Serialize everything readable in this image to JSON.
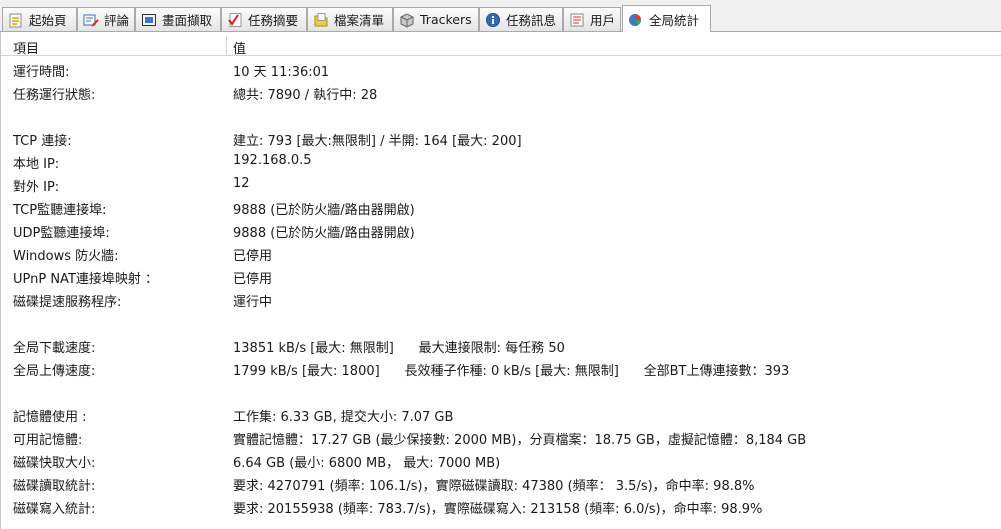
{
  "tabs": [
    {
      "label": "起始頁",
      "icon": "start-page-icon"
    },
    {
      "label": "評論",
      "icon": "comments-icon"
    },
    {
      "label": "畫面擷取",
      "icon": "screenshot-icon"
    },
    {
      "label": "任務摘要",
      "icon": "checklist-icon"
    },
    {
      "label": "檔案清單",
      "icon": "file-list-icon"
    },
    {
      "label": "Trackers",
      "icon": "trackers-icon"
    },
    {
      "label": "任務訊息",
      "icon": "info-icon"
    },
    {
      "label": "用戶",
      "icon": "users-icon"
    },
    {
      "label": "全局統計",
      "icon": "statistics-icon"
    }
  ],
  "active_tab": 8,
  "columns": {
    "item": "項目",
    "value": "值"
  },
  "rows": [
    {
      "label": "運行時間:",
      "value": "10 天 11:36:01"
    },
    {
      "label": "任務運行狀態:",
      "value": "總共: 7890 / 執行中: 28"
    },
    {
      "label": "",
      "value": ""
    },
    {
      "label": "TCP 連接:",
      "value": "建立: 793 [最大:無限制] / 半開: 164 [最大: 200]"
    },
    {
      "label": "本地 IP:",
      "value": "192.168.0.5"
    },
    {
      "label": "對外 IP:",
      "value": "12"
    },
    {
      "label": "TCP監聽連接埠:",
      "value": "9888 (已於防火牆/路由器開啟)"
    },
    {
      "label": "UDP監聽連接埠:",
      "value": "9888 (已於防火牆/路由器開啟)"
    },
    {
      "label": "Windows 防火牆:",
      "value": "已停用"
    },
    {
      "label": "UPnP NAT連接埠映射 ：",
      "value": "已停用"
    },
    {
      "label": "磁碟提速服務程序:",
      "value": "運行中"
    },
    {
      "label": "",
      "value": ""
    },
    {
      "label": "全局下載速度:",
      "value": "13851 kB/s [最大: 無限制]      最大連接限制: 每任務 50"
    },
    {
      "label": "全局上傳速度:",
      "value": "1799 kB/s [最大: 1800]      長效種子作種: 0 kB/s [最大: 無限制]      全部BT上傳連接數：393"
    },
    {
      "label": "",
      "value": ""
    },
    {
      "label": "記憶體使用 :",
      "value": "工作集: 6.33 GB, 提交大小: 7.07 GB"
    },
    {
      "label": "可用記憶體:",
      "value": "實體記憶體：17.27 GB (最少保接數: 2000 MB)，分頁檔案：18.75 GB，虛擬記憶體：8,184 GB"
    },
    {
      "label": "磁碟快取大小:",
      "value": "6.64 GB (最小: 6800 MB， 最大: 7000 MB)"
    },
    {
      "label": "磁碟讀取統計:",
      "value": "要求: 4270791 (頻率: 106.1/s)，實際磁碟讀取: 47380 (頻率： 3.5/s)，命中率: 98.8%"
    },
    {
      "label": "磁碟寫入統計:",
      "value": "要求: 20155938 (頻率: 783.7/s)，實際磁碟寫入: 213158 (頻率: 6.0/s)，命中率: 98.9%"
    }
  ]
}
